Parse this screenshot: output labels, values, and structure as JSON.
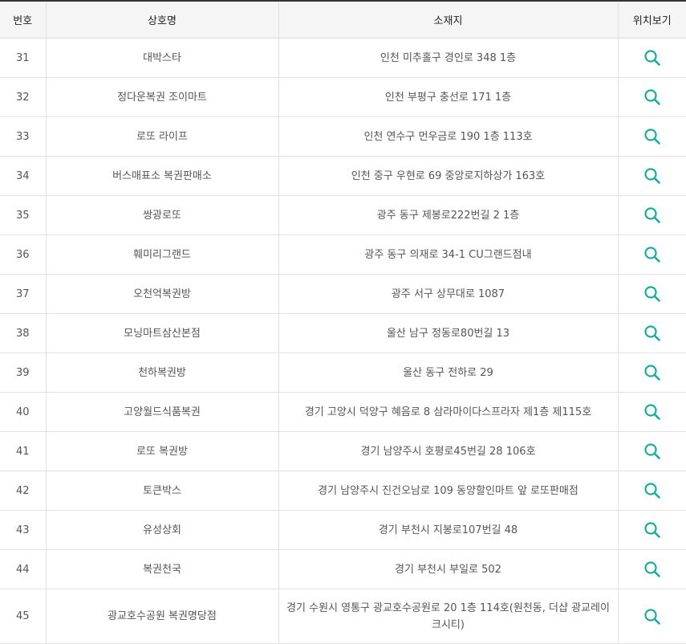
{
  "table": {
    "headers": [
      "번호",
      "상호명",
      "소재지",
      "위치보기"
    ],
    "rows": [
      {
        "no": "31",
        "name": "대박스타",
        "address": "인천 미추홀구 경인로 348 1층"
      },
      {
        "no": "32",
        "name": "정다운복권 조이마트",
        "address": "인천 부평구 충선로 171 1층"
      },
      {
        "no": "33",
        "name": "로또 라이프",
        "address": "인천 연수구 먼우금로 190 1층 113호"
      },
      {
        "no": "34",
        "name": "버스매표소 복권판매소",
        "address": "인천 중구 우현로 69 중앙로지하상가 163호"
      },
      {
        "no": "35",
        "name": "쌍광로또",
        "address": "광주 동구 제봉로222번길 2 1층"
      },
      {
        "no": "36",
        "name": "훼미리그랜드",
        "address": "광주 동구 의재로 34-1 CU그랜드점내"
      },
      {
        "no": "37",
        "name": "오천억복권방",
        "address": "광주 서구 상무대로 1087"
      },
      {
        "no": "38",
        "name": "모닝마트삼산본점",
        "address": "울산 남구 정동로80번길 13"
      },
      {
        "no": "39",
        "name": "천하복권방",
        "address": "울산 동구 전하로 29"
      },
      {
        "no": "40",
        "name": "고양월드식품복권",
        "address": "경기 고양시 덕양구 혜음로 8 삼라마이다스프라자 제1층 제115호"
      },
      {
        "no": "41",
        "name": "로또 복권방",
        "address": "경기 남양주시 호평로45번길 28 106호"
      },
      {
        "no": "42",
        "name": "토큰박스",
        "address": "경기 남양주시 진건오남로 109 동양할인마트 앞 로또판매점"
      },
      {
        "no": "43",
        "name": "유성상회",
        "address": "경기 부천시 지봉로107번길 48"
      },
      {
        "no": "44",
        "name": "복권천국",
        "address": "경기 부천시 부일로 502"
      },
      {
        "no": "45",
        "name": "광교호수공원 복권명당점",
        "address": "경기 수원시 영통구 광교호수공원로 20 1층 114호(원천동, 더샵 광교레이크시티)"
      }
    ]
  },
  "icons": {
    "search": "search-icon"
  },
  "colors": {
    "accent": "#1aab9b",
    "header_bg": "#f5f5f5",
    "top_border": "#333333"
  }
}
